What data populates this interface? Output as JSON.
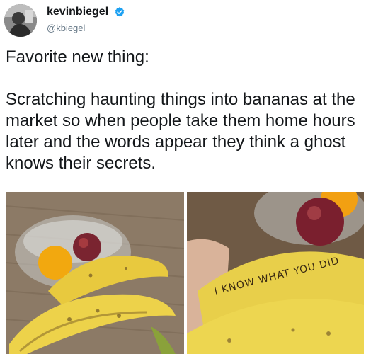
{
  "tweet": {
    "display_name": "kevinbiegel",
    "handle": "@kbiegel",
    "paragraphs": [
      "Favorite new thing:",
      "Scratching haunting things into bananas at the market so when people take them home hours later and the words appear they think a ghost knows their secrets."
    ],
    "verified_icon": "verified-badge-icon"
  },
  "photos": {
    "right": {
      "banana_text": "I KNOW WHAT YOU DID"
    }
  },
  "colors": {
    "verified": "#1da1f2",
    "handle": "#657786",
    "text": "#14171a"
  }
}
